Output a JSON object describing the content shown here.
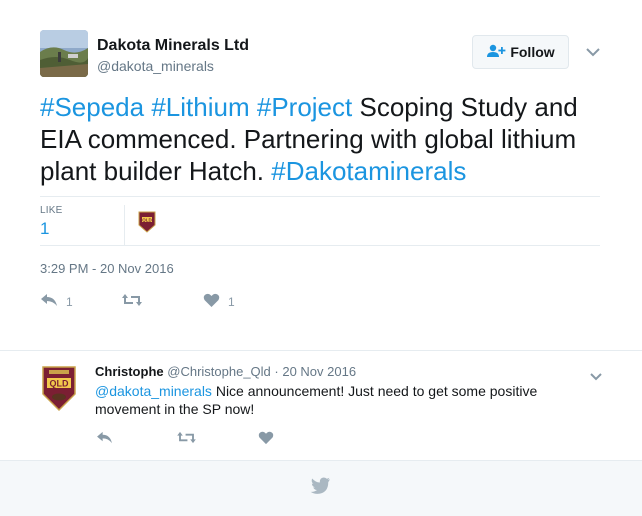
{
  "tweet": {
    "author_name": "Dakota Minerals Ltd",
    "author_handle": "@dakota_minerals",
    "follow_label": "Follow",
    "text_segments": [
      {
        "text": "#Sepeda",
        "type": "hashtag"
      },
      {
        "text": " ",
        "type": "text"
      },
      {
        "text": "#Lithium",
        "type": "hashtag"
      },
      {
        "text": " ",
        "type": "text"
      },
      {
        "text": "#Project",
        "type": "hashtag"
      },
      {
        "text": " Scoping Study and EIA commenced. Partnering with global lithium plant builder Hatch. ",
        "type": "text"
      },
      {
        "text": "#Dakotaminerals",
        "type": "hashtag"
      }
    ],
    "like_label": "LIKE",
    "like_count": "1",
    "timestamp": "3:29 PM - 20 Nov 2016",
    "actions": {
      "reply_count": "1",
      "retweet_count": "",
      "like_count": "1"
    }
  },
  "reply": {
    "name": "Christophe",
    "handle": "@Christophe_Qld",
    "date": " · 20 Nov 2016",
    "mention": "@dakota_minerals",
    "text": " Nice announcement! Just need to get some positive movement in the SP now!"
  },
  "colors": {
    "accent": "#1b95e0",
    "muted": "#8899a6",
    "divider": "#e6ecf0"
  },
  "icons": [
    "follow-person-icon",
    "chevron-down-icon",
    "reply-icon",
    "retweet-icon",
    "heart-icon",
    "twitter-bird-icon",
    "qld-maroons-badge-icon"
  ]
}
